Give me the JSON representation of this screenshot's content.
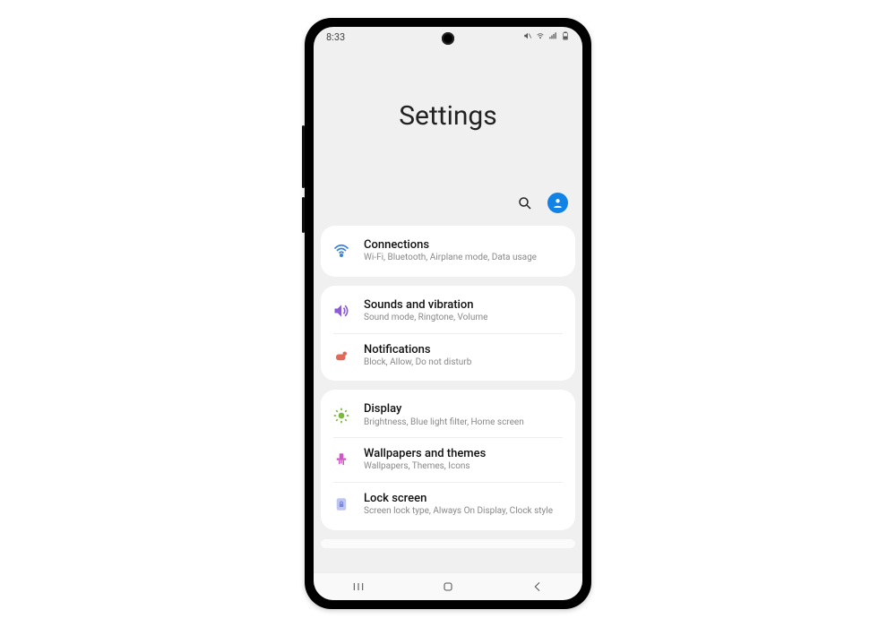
{
  "status": {
    "time": "8:33"
  },
  "page": {
    "title": "Settings"
  },
  "groups": [
    {
      "items": [
        {
          "title": "Connections",
          "sub": "Wi-Fi, Bluetooth, Airplane mode, Data usage",
          "icon": "wifi",
          "color": "#3b82d8"
        }
      ]
    },
    {
      "items": [
        {
          "title": "Sounds and vibration",
          "sub": "Sound mode, Ringtone, Volume",
          "icon": "speaker",
          "color": "#8a5cd6"
        },
        {
          "title": "Notifications",
          "sub": "Block, Allow, Do not disturb",
          "icon": "notification",
          "color": "#e06a5a"
        }
      ]
    },
    {
      "items": [
        {
          "title": "Display",
          "sub": "Brightness, Blue light filter, Home screen",
          "icon": "brightness",
          "color": "#7bb93f"
        },
        {
          "title": "Wallpapers and themes",
          "sub": "Wallpapers, Themes, Icons",
          "icon": "brush",
          "color": "#d056c6"
        },
        {
          "title": "Lock screen",
          "sub": "Screen lock type, Always On Display, Clock style",
          "icon": "lock",
          "color": "#7a86e0"
        }
      ]
    }
  ]
}
